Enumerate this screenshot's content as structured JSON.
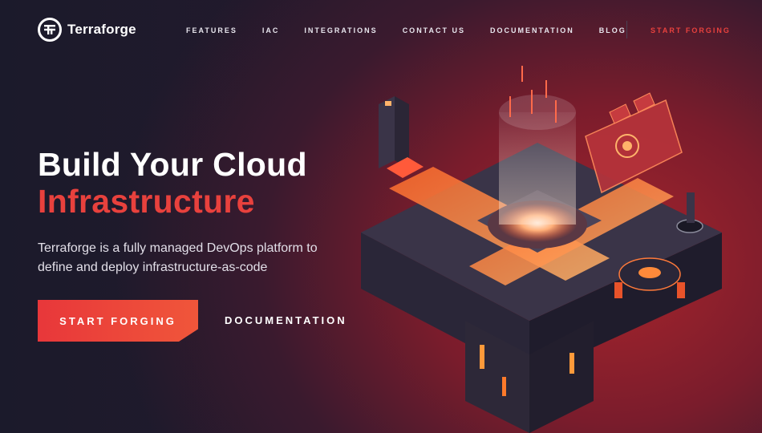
{
  "brand": {
    "name": "Terraforge",
    "logo_icon": "terraforge-logo-icon"
  },
  "nav": {
    "items": [
      "FEATURES",
      "IAC",
      "INTEGRATIONS",
      "CONTACT US",
      "DOCUMENTATION",
      "BLOG"
    ],
    "cta": "START FORGING"
  },
  "hero": {
    "title_line1": "Build Your Cloud",
    "title_line2": "Infrastructure",
    "subtitle": "Terraforge is a fully managed DevOps platform to define and deploy infrastructure-as-code",
    "primary_button": "START FORGING",
    "secondary_button": "DOCUMENTATION"
  },
  "colors": {
    "accent": "#e8413d",
    "background": "#1b1a2b",
    "glow": "#ff7a3a"
  }
}
